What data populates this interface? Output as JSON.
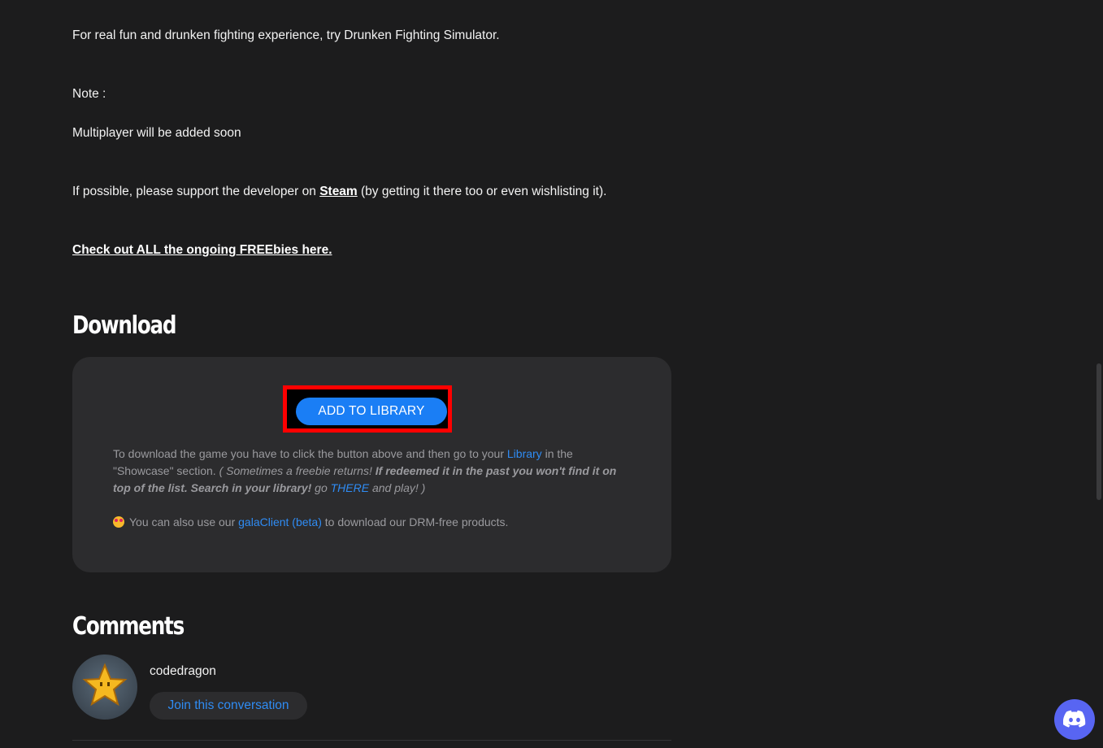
{
  "article": {
    "p1": "For real fun and drunken fighting experience, try Drunken Fighting Simulator.",
    "note_label": "Note :",
    "note_text": "Multiplayer will be added soon",
    "support_before": "If possible, please support the developer on ",
    "support_link": "Steam",
    "support_after": " (by getting it there too or even wishlisting it).",
    "freebies_link": "Check out ALL the ongoing FREEbies here."
  },
  "download": {
    "title": "Download",
    "button_label": "ADD TO LIBRARY",
    "text_1": "To download the game you have to click the button above and then go to your ",
    "library_link": "Library",
    "text_2": " in the \"Showcase\" section. ",
    "italic_1": "( Sometimes a freebie returns! ",
    "bold_italic": "If redeemed it in the past you won't find it on top of the list. Search in your library!",
    "italic_2": " go ",
    "there_link": "THERE",
    "italic_3": " and play! )",
    "client_before": "You can also use our ",
    "client_link": "galaClient (beta)",
    "client_after": " to download our DRM-free products."
  },
  "comments": {
    "title": "Comments",
    "username": "codedragon",
    "join_label": "Join this conversation"
  },
  "icons": {
    "avatar": "star-avatar",
    "emoji": "star-struck-emoji",
    "chat": "discord-icon"
  },
  "colors": {
    "background": "#1c1c1d",
    "panel": "#2c2c2e",
    "accent_blue": "#1a7ef5",
    "link_blue": "#2f8cf4",
    "highlight_red": "#ff0000",
    "discord": "#5865f2"
  }
}
